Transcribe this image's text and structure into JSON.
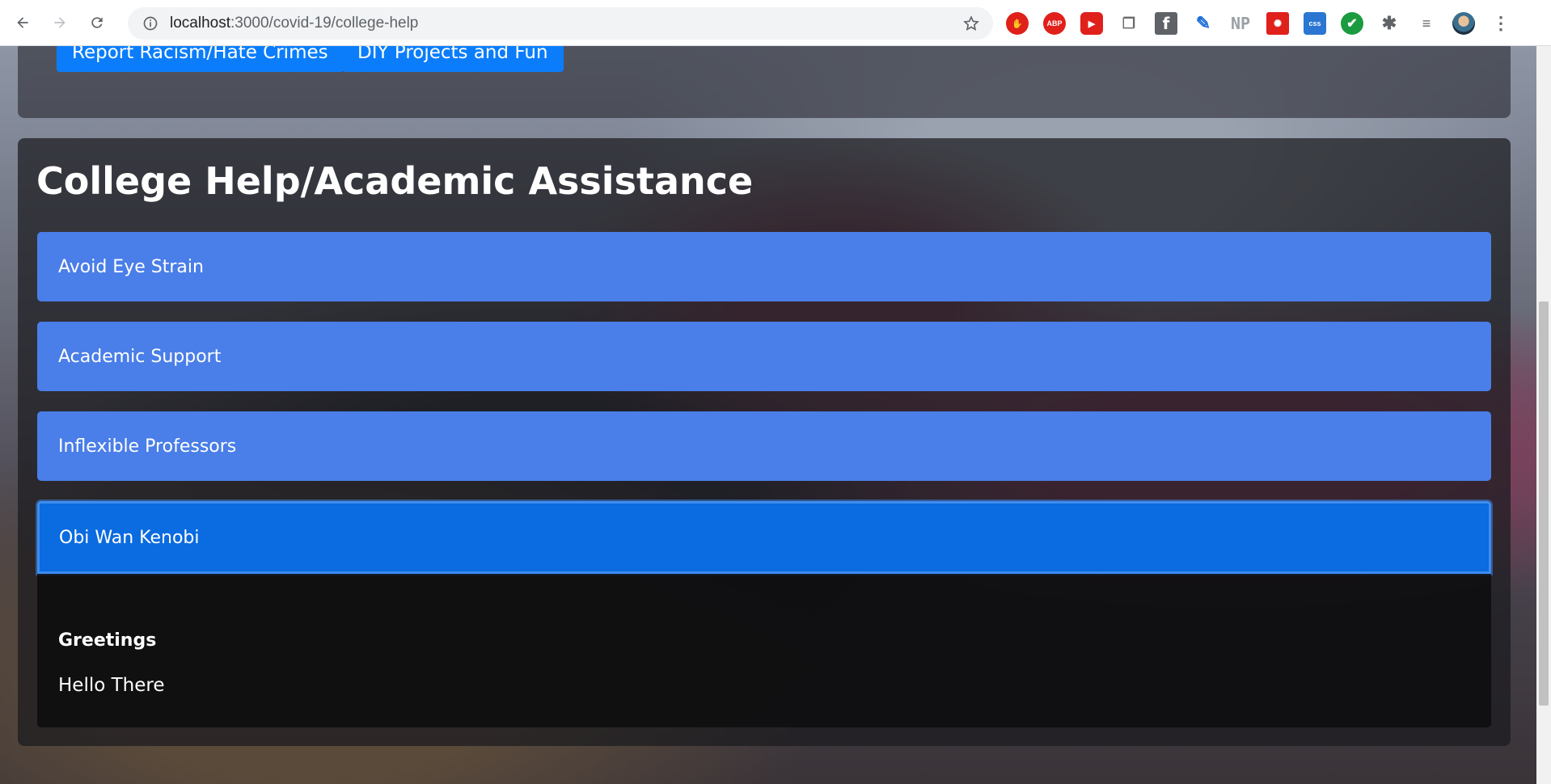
{
  "browser": {
    "url_host": "localhost",
    "url_path": ":3000/covid-19/college-help",
    "extensions": [
      "stop-icon",
      "abp-icon",
      "red-play-icon",
      "stack-icon",
      "facebook-icon",
      "feather-icon",
      "np-icon",
      "bug-icon",
      "css-icon",
      "check-icon",
      "puzzle-icon",
      "media-icon",
      "avatar",
      "menu-icon"
    ],
    "ext_labels": {
      "abp": "ABP",
      "np": "NP",
      "css": "css",
      "fb": "f"
    }
  },
  "top_buttons": {
    "report": "Report Racism/Hate Crimes",
    "diy": "DIY Projects and Fun"
  },
  "main": {
    "title": "College Help/Academic Assistance",
    "items": [
      {
        "label": "Avoid Eye Strain"
      },
      {
        "label": "Academic Support"
      },
      {
        "label": "Inflexible Professors"
      },
      {
        "label": "Obi Wan Kenobi"
      }
    ],
    "expanded": {
      "heading": "Greetings",
      "body": "Hello There"
    }
  }
}
